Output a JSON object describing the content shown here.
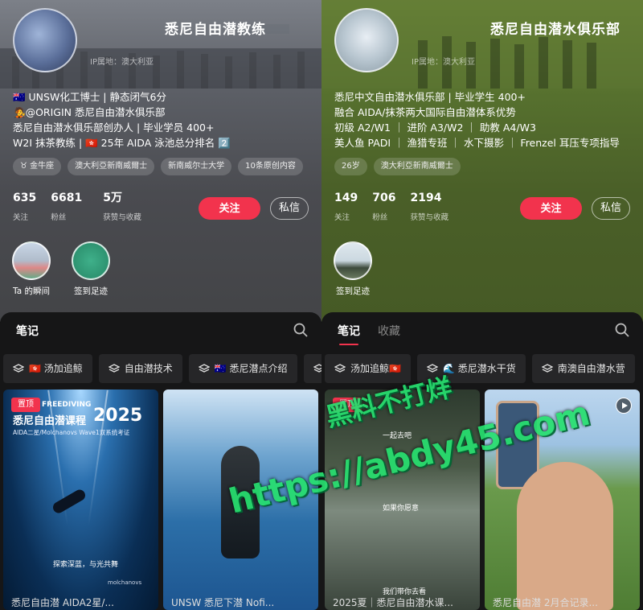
{
  "left": {
    "name": "悉尼自由潜教练",
    "ip": "IP属地：澳大利亚",
    "bio": [
      "🇦🇺 UNSW化工博士 | 静态闭气6分",
      "🧑‍🎤@ORIGIN 悉尼自由潜水俱乐部",
      "悉尼自由潜水俱乐部创办人 | 毕业学员 400+",
      "W2I 抹茶教练 | 🇭🇰 25年 AIDA 泳池总分排名 2️⃣"
    ],
    "tags": [
      "♉ 金牛座",
      "澳大利亞新南威爾士",
      "新南威尔士大学",
      "10条原创内容"
    ],
    "stats": [
      {
        "num": "635",
        "label": "关注"
      },
      {
        "num": "6681",
        "label": "粉丝"
      },
      {
        "num": "5万",
        "label": "获赞与收藏"
      }
    ],
    "follow": "关注",
    "message": "私信",
    "highlights": [
      "Ta 的瞬间",
      "签到足迹"
    ],
    "tabs": [
      "笔记"
    ],
    "collections": [
      "🇭🇰 汤加追鲸",
      "自由潜技术",
      "🇦🇺 悉尼潜点介绍"
    ],
    "cards": [
      {
        "pin": "置顶",
        "headline_small": "FREEDIVING",
        "headline": "悉尼自由潜课程",
        "year": "2025",
        "sub": "AIDA二星/Molchanovs Wave1双系统考证",
        "slogan": "探索深蓝，与光共舞",
        "logo": "molchanovs",
        "title": "悉尼自由潜 AIDA2星/..."
      },
      {
        "title": "UNSW 悉尼下潜 Nofi..."
      }
    ]
  },
  "right": {
    "name": "悉尼自由潜水俱乐部",
    "ip": "IP属地：澳大利亚",
    "bio": [
      "悉尼中文自由潜水俱乐部 | 毕业学生 400+",
      "融合 AIDA/抹茶两大国际自由潜体系优势",
      "初级 A2/W1 ｜ 进阶 A3/W2 ｜ 助教 A4/W3",
      "美人鱼 PADI ｜ 渔猎专班 ｜ 水下摄影 ｜ Frenzel 耳压专项指导"
    ],
    "tags": [
      "26岁",
      "澳大利亞新南威爾士"
    ],
    "stats": [
      {
        "num": "149",
        "label": "关注"
      },
      {
        "num": "706",
        "label": "粉丝"
      },
      {
        "num": "2194",
        "label": "获赞与收藏"
      }
    ],
    "follow": "关注",
    "message": "私信",
    "highlights": [
      "签到足迹"
    ],
    "tabs": [
      "笔记",
      "收藏"
    ],
    "collections": [
      "汤加追鲸🇭🇰",
      "🌊 悉尼潜水干货",
      "南澳自由潜水营"
    ],
    "cards": [
      {
        "pin": "置顶",
        "caption1": "一起去吧",
        "caption2": "如果你愿意",
        "caption3": "我们带你去看",
        "title": "2025夏｜悉尼自由潜水课..."
      },
      {
        "title": "悉尼自由潜 2月合记录..."
      }
    ]
  },
  "watermark": {
    "line1": "黑料不打烊",
    "line2": "https://abdy45.com"
  },
  "colors": {
    "accent": "#f2334d",
    "watermark": "#27e06f",
    "left_bg": "#4a4b50",
    "right_bg": "#4a5f28"
  }
}
